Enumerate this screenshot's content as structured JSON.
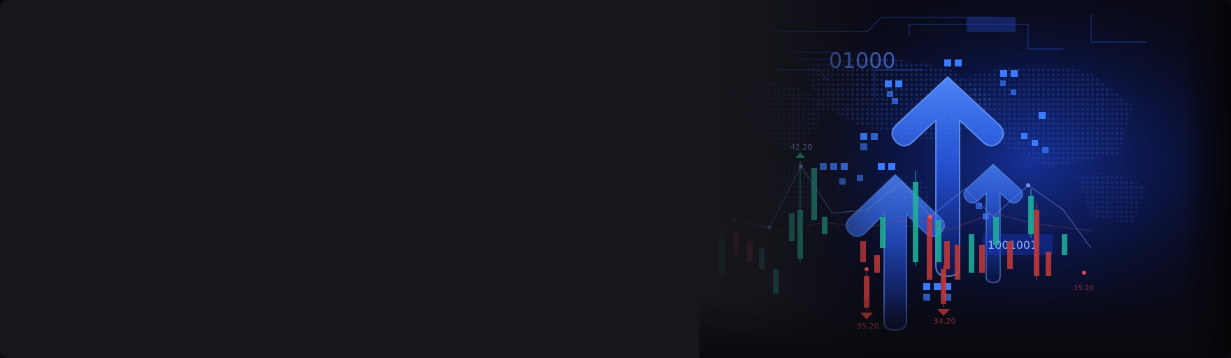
{
  "hero_image": {
    "binary_readout": "01000",
    "price_labels": {
      "high": "42.20",
      "low_left": "35.20",
      "low_right": "34.20",
      "edge_right": "15.20"
    },
    "matrix_readout": "1001001",
    "colors": {
      "background": "#16161b",
      "glow_blue": "#1f4fff",
      "arrow_blue": "#3d7bff",
      "bull_candle": "#1fb39a",
      "bear_candle": "#c63a3a"
    },
    "icons": [
      "up-arrow-large",
      "up-arrow-small-left",
      "up-arrow-small-right",
      "candlestick-chart",
      "world-map-dots"
    ]
  }
}
